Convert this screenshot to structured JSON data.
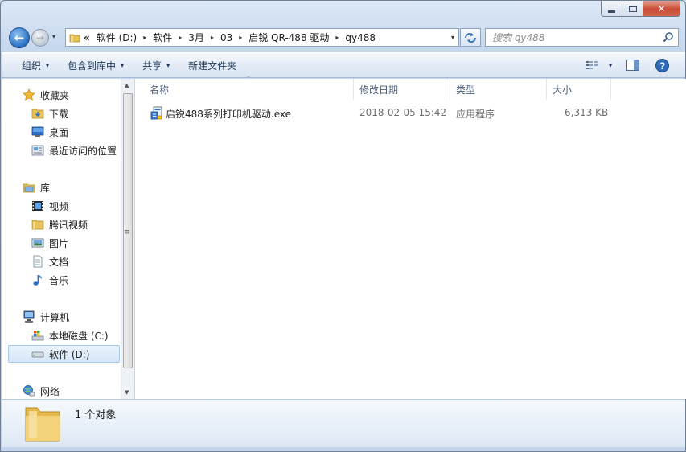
{
  "window": {
    "controls": {
      "minimize": "–",
      "maximize": "□",
      "close": "✕"
    }
  },
  "navigation": {
    "back_icon": "arrow-left-icon",
    "forward_icon": "arrow-right-icon",
    "history_dropdown": "▾",
    "breadcrumb_overflow": "«",
    "breadcrumbs": [
      "软件 (D:)",
      "软件",
      "3月",
      "03",
      "启锐 QR-488 驱动",
      "qy488"
    ],
    "separator": "▸",
    "dropdown": "▾",
    "refresh_icon": "refresh-icon"
  },
  "search": {
    "placeholder": "搜索 qy488"
  },
  "toolbar": {
    "organize": "组织",
    "include_in_library": "包含到库中",
    "share": "共享",
    "new_folder": "新建文件夹",
    "dropdown_arrow": "▾"
  },
  "nav_pane": {
    "favorites": {
      "label": "收藏夹",
      "icon": "star-icon"
    },
    "favorites_items": [
      {
        "label": "下载",
        "icon": "download-folder-icon"
      },
      {
        "label": "桌面",
        "icon": "desktop-icon"
      },
      {
        "label": "最近访问的位置",
        "icon": "recent-places-icon"
      }
    ],
    "libraries": {
      "label": "库",
      "icon": "library-icon"
    },
    "libraries_items": [
      {
        "label": "视频",
        "icon": "video-icon"
      },
      {
        "label": "腾讯视频",
        "icon": "folder-icon"
      },
      {
        "label": "图片",
        "icon": "pictures-icon"
      },
      {
        "label": "文档",
        "icon": "documents-icon"
      },
      {
        "label": "音乐",
        "icon": "music-icon"
      }
    ],
    "computer": {
      "label": "计算机",
      "icon": "computer-icon"
    },
    "computer_items": [
      {
        "label": "本地磁盘 (C:)",
        "icon": "system-drive-icon"
      },
      {
        "label": "软件 (D:)",
        "icon": "drive-icon",
        "selected": true
      }
    ],
    "network": {
      "label": "网络",
      "icon": "network-icon"
    }
  },
  "file_list": {
    "columns": {
      "name": "名称",
      "date_modified": "修改日期",
      "type": "类型",
      "size": "大小"
    },
    "sort_indicator": "^",
    "files": [
      {
        "name": "启锐488系列打印机驱动.exe",
        "date_modified": "2018-02-05 15:42",
        "type": "应用程序",
        "size": "6,313 KB",
        "icon": "installer-icon"
      }
    ]
  },
  "details": {
    "count_text": "1 个对象",
    "icon": "folder-large-icon"
  },
  "colors": {
    "selection": "#d6e7f8",
    "accent": "#2a6fc3",
    "close_button": "#c94b36"
  }
}
